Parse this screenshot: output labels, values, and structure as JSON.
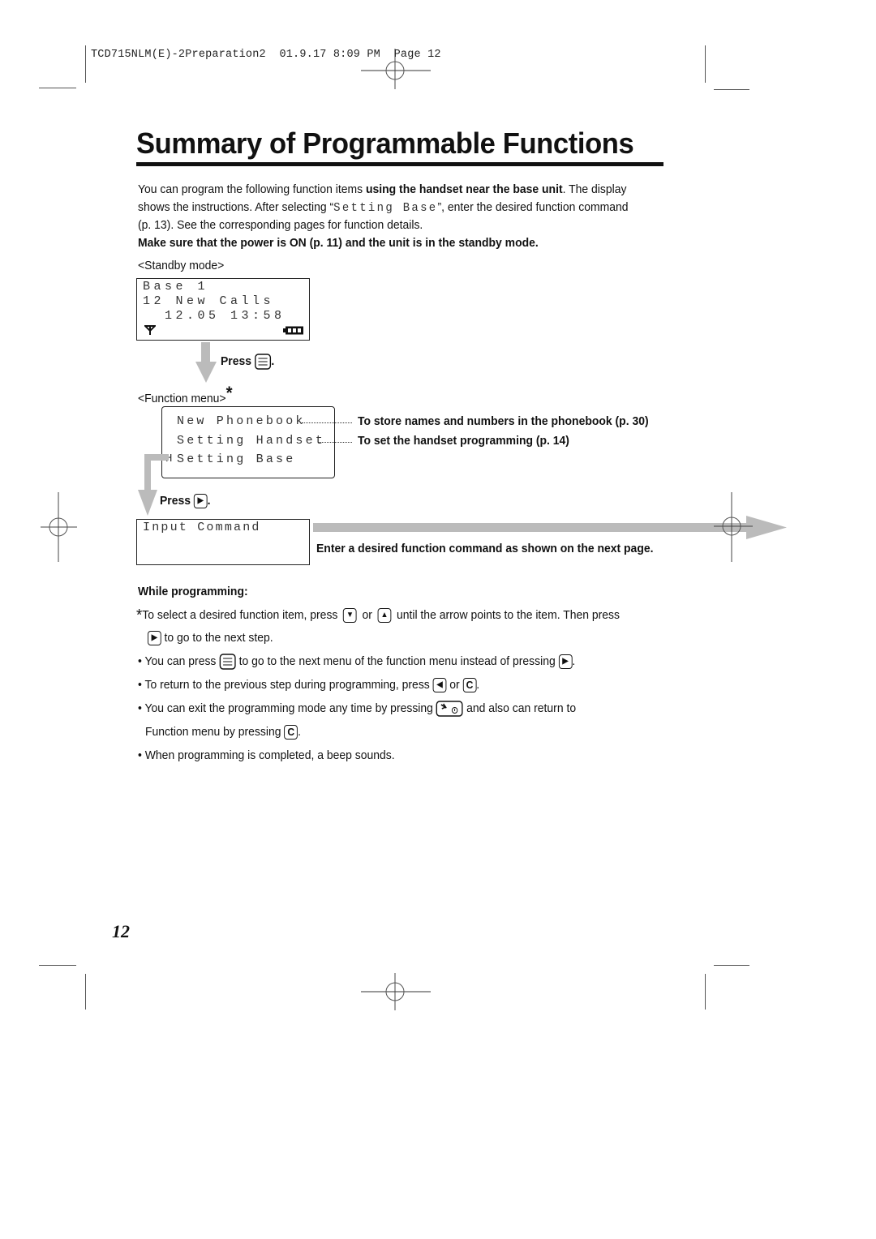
{
  "slug": {
    "file": "TCD715NLM(E)-2Preparation2",
    "date": "01.9.17",
    "time": "8:09 PM",
    "page_label": "Page 12"
  },
  "title": "Summary of Programmable Functions",
  "intro": {
    "line1_a": "You can program the following function items ",
    "line1_b": "using the handset near the base unit",
    "line1_c": ". The display",
    "line2_a": "shows the instructions. After selecting “",
    "line2_mono": "Setting Base",
    "line2_c": "”, enter the desired function command",
    "line3": "(p. 13). See the corresponding pages for function details.",
    "line4": "Make sure that the power is ON (p. 11) and the unit is in the standby mode."
  },
  "standby": {
    "label": "<Standby mode>",
    "lines": [
      "Base 1",
      "12 New Calls",
      "  12.05 13:58"
    ],
    "antenna_icon": "antenna-icon",
    "battery_icon": "battery-icon"
  },
  "step1": {
    "press": "Press",
    "key_icon": "menu-key-icon",
    "end": "."
  },
  "function_menu": {
    "label": "<Function menu>",
    "asterisk": "*",
    "items": [
      {
        "text": "New Phonebook",
        "desc": "To store names and numbers in the phonebook (p. 30)"
      },
      {
        "text": "Setting Handset",
        "desc": "To set the handset programming (p. 14)"
      },
      {
        "text": "Setting Base",
        "desc": ""
      }
    ],
    "cursor": "H"
  },
  "step2": {
    "press": "Press",
    "key_icon": "right-key-icon",
    "end": "."
  },
  "input_command": {
    "lcd": "Input Command",
    "instruction": "Enter a desired function command as shown on the next page."
  },
  "while_programming": {
    "heading": "While programming:",
    "note_star": "*",
    "note_a": "To select a desired function item, press",
    "note_or": "or",
    "note_b": "until  the arrow points to the item. Then press",
    "note_c": "to go to the next step.",
    "bullets": [
      {
        "a": "You can press",
        "b": "to go to the next menu of the function menu instead of pressing",
        "c": "."
      },
      {
        "a": "To return to the previous step during programming, press",
        "or": "or",
        "c": "."
      },
      {
        "a": "You can exit the programming mode any time by pressing",
        "b": "and also can return to",
        "line2": "Function menu  by pressing",
        "c": "."
      },
      {
        "a": "When programming is completed, a beep sounds."
      }
    ],
    "keys": {
      "down": "▼",
      "up": "▲",
      "right": "▶",
      "left": "◀",
      "clear": "C"
    }
  },
  "page_number": "12"
}
